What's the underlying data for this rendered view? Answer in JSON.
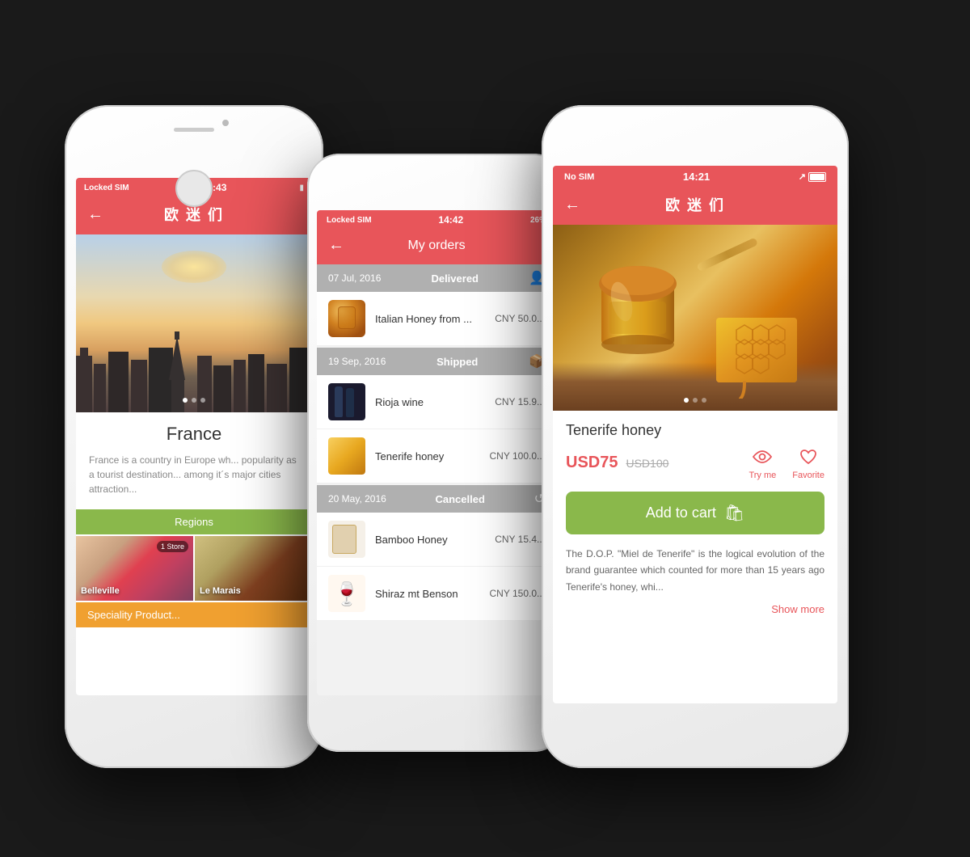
{
  "phone1": {
    "status": {
      "carrier": "Locked SIM",
      "wifi": true,
      "time": "14:43"
    },
    "header": {
      "title": "欧 迷 们",
      "back_label": "←"
    },
    "country": {
      "name": "France",
      "description": "France is a country in Europe wh... popularity as a tourist destination... among it´s major cities attraction..."
    },
    "regions_label": "Regions",
    "regions": [
      {
        "name": "Belleville",
        "store_count": "1 Store"
      },
      {
        "name": "Le Marais",
        "store_count": ""
      }
    ],
    "speciality_label": "Speciality Product..."
  },
  "phone2": {
    "status": {
      "carrier": "Locked SIM",
      "wifi": true,
      "time": "14:42",
      "percent": "26%"
    },
    "header": {
      "title": "My orders",
      "back_label": "←"
    },
    "order_groups": [
      {
        "date": "07 Jul, 2016",
        "status": "Delivered",
        "items": [
          {
            "name": "Italian Honey from ...",
            "price": "CNY 50.0..."
          }
        ]
      },
      {
        "date": "19 Sep, 2016",
        "status": "Shipped",
        "items": [
          {
            "name": "Rioja wine",
            "price": "CNY 15.9..."
          },
          {
            "name": "Tenerife honey",
            "price": "CNY 100.0..."
          }
        ]
      },
      {
        "date": "20 May, 2016",
        "status": "Cancelled",
        "items": [
          {
            "name": "Bamboo Honey",
            "price": "CNY 15.4..."
          },
          {
            "name": "Shiraz mt Benson",
            "price": "CNY 150.0..."
          }
        ]
      }
    ]
  },
  "phone3": {
    "status": {
      "carrier": "No SIM",
      "wifi": true,
      "time": "14:21",
      "location": true,
      "battery_full": true
    },
    "header": {
      "title": "欧 迷 们",
      "back_label": "←"
    },
    "product": {
      "name": "Tenerife honey",
      "price_current": "USD75",
      "price_original": "USD100",
      "try_me_label": "Try me",
      "favorite_label": "Favorite",
      "add_to_cart_label": "Add to cart",
      "description": "The D.O.P. \"Miel de Tenerife\" is the logical evolution of the brand guarantee which counted for more than 15 years ago Tenerife's honey, whi...",
      "show_more_label": "Show more"
    }
  }
}
